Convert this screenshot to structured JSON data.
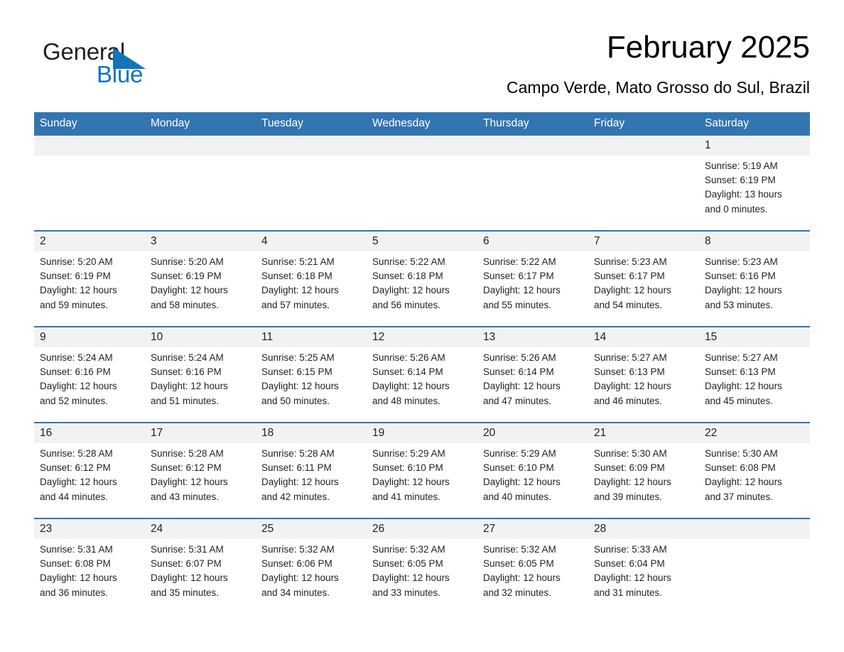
{
  "brand": {
    "name_part1": "General",
    "name_part2": "Blue",
    "triangle_color": "#1573ba",
    "text_color": "#231f20"
  },
  "header": {
    "title": "February 2025",
    "subtitle": "Campo Verde, Mato Grosso do Sul, Brazil"
  },
  "theme": {
    "header_blue": "#3375b0",
    "row_border_blue": "#3375b0",
    "daynum_background": "#f2f2f2",
    "text": "#231f20",
    "page_background": "#ffffff"
  },
  "calendar": {
    "weekday_headers": [
      "Sunday",
      "Monday",
      "Tuesday",
      "Wednesday",
      "Thursday",
      "Friday",
      "Saturday"
    ],
    "weeks": [
      [
        {
          "blank": true,
          "day": ""
        },
        {
          "blank": true,
          "day": ""
        },
        {
          "blank": true,
          "day": ""
        },
        {
          "blank": true,
          "day": ""
        },
        {
          "blank": true,
          "day": ""
        },
        {
          "blank": true,
          "day": ""
        },
        {
          "blank": false,
          "day": "1",
          "sunrise": "Sunrise: 5:19 AM",
          "sunset": "Sunset: 6:19 PM",
          "daylight_line1": "Daylight: 13 hours",
          "daylight_line2": "and 0 minutes."
        }
      ],
      [
        {
          "blank": false,
          "day": "2",
          "sunrise": "Sunrise: 5:20 AM",
          "sunset": "Sunset: 6:19 PM",
          "daylight_line1": "Daylight: 12 hours",
          "daylight_line2": "and 59 minutes."
        },
        {
          "blank": false,
          "day": "3",
          "sunrise": "Sunrise: 5:20 AM",
          "sunset": "Sunset: 6:19 PM",
          "daylight_line1": "Daylight: 12 hours",
          "daylight_line2": "and 58 minutes."
        },
        {
          "blank": false,
          "day": "4",
          "sunrise": "Sunrise: 5:21 AM",
          "sunset": "Sunset: 6:18 PM",
          "daylight_line1": "Daylight: 12 hours",
          "daylight_line2": "and 57 minutes."
        },
        {
          "blank": false,
          "day": "5",
          "sunrise": "Sunrise: 5:22 AM",
          "sunset": "Sunset: 6:18 PM",
          "daylight_line1": "Daylight: 12 hours",
          "daylight_line2": "and 56 minutes."
        },
        {
          "blank": false,
          "day": "6",
          "sunrise": "Sunrise: 5:22 AM",
          "sunset": "Sunset: 6:17 PM",
          "daylight_line1": "Daylight: 12 hours",
          "daylight_line2": "and 55 minutes."
        },
        {
          "blank": false,
          "day": "7",
          "sunrise": "Sunrise: 5:23 AM",
          "sunset": "Sunset: 6:17 PM",
          "daylight_line1": "Daylight: 12 hours",
          "daylight_line2": "and 54 minutes."
        },
        {
          "blank": false,
          "day": "8",
          "sunrise": "Sunrise: 5:23 AM",
          "sunset": "Sunset: 6:16 PM",
          "daylight_line1": "Daylight: 12 hours",
          "daylight_line2": "and 53 minutes."
        }
      ],
      [
        {
          "blank": false,
          "day": "9",
          "sunrise": "Sunrise: 5:24 AM",
          "sunset": "Sunset: 6:16 PM",
          "daylight_line1": "Daylight: 12 hours",
          "daylight_line2": "and 52 minutes."
        },
        {
          "blank": false,
          "day": "10",
          "sunrise": "Sunrise: 5:24 AM",
          "sunset": "Sunset: 6:16 PM",
          "daylight_line1": "Daylight: 12 hours",
          "daylight_line2": "and 51 minutes."
        },
        {
          "blank": false,
          "day": "11",
          "sunrise": "Sunrise: 5:25 AM",
          "sunset": "Sunset: 6:15 PM",
          "daylight_line1": "Daylight: 12 hours",
          "daylight_line2": "and 50 minutes."
        },
        {
          "blank": false,
          "day": "12",
          "sunrise": "Sunrise: 5:26 AM",
          "sunset": "Sunset: 6:14 PM",
          "daylight_line1": "Daylight: 12 hours",
          "daylight_line2": "and 48 minutes."
        },
        {
          "blank": false,
          "day": "13",
          "sunrise": "Sunrise: 5:26 AM",
          "sunset": "Sunset: 6:14 PM",
          "daylight_line1": "Daylight: 12 hours",
          "daylight_line2": "and 47 minutes."
        },
        {
          "blank": false,
          "day": "14",
          "sunrise": "Sunrise: 5:27 AM",
          "sunset": "Sunset: 6:13 PM",
          "daylight_line1": "Daylight: 12 hours",
          "daylight_line2": "and 46 minutes."
        },
        {
          "blank": false,
          "day": "15",
          "sunrise": "Sunrise: 5:27 AM",
          "sunset": "Sunset: 6:13 PM",
          "daylight_line1": "Daylight: 12 hours",
          "daylight_line2": "and 45 minutes."
        }
      ],
      [
        {
          "blank": false,
          "day": "16",
          "sunrise": "Sunrise: 5:28 AM",
          "sunset": "Sunset: 6:12 PM",
          "daylight_line1": "Daylight: 12 hours",
          "daylight_line2": "and 44 minutes."
        },
        {
          "blank": false,
          "day": "17",
          "sunrise": "Sunrise: 5:28 AM",
          "sunset": "Sunset: 6:12 PM",
          "daylight_line1": "Daylight: 12 hours",
          "daylight_line2": "and 43 minutes."
        },
        {
          "blank": false,
          "day": "18",
          "sunrise": "Sunrise: 5:28 AM",
          "sunset": "Sunset: 6:11 PM",
          "daylight_line1": "Daylight: 12 hours",
          "daylight_line2": "and 42 minutes."
        },
        {
          "blank": false,
          "day": "19",
          "sunrise": "Sunrise: 5:29 AM",
          "sunset": "Sunset: 6:10 PM",
          "daylight_line1": "Daylight: 12 hours",
          "daylight_line2": "and 41 minutes."
        },
        {
          "blank": false,
          "day": "20",
          "sunrise": "Sunrise: 5:29 AM",
          "sunset": "Sunset: 6:10 PM",
          "daylight_line1": "Daylight: 12 hours",
          "daylight_line2": "and 40 minutes."
        },
        {
          "blank": false,
          "day": "21",
          "sunrise": "Sunrise: 5:30 AM",
          "sunset": "Sunset: 6:09 PM",
          "daylight_line1": "Daylight: 12 hours",
          "daylight_line2": "and 39 minutes."
        },
        {
          "blank": false,
          "day": "22",
          "sunrise": "Sunrise: 5:30 AM",
          "sunset": "Sunset: 6:08 PM",
          "daylight_line1": "Daylight: 12 hours",
          "daylight_line2": "and 37 minutes."
        }
      ],
      [
        {
          "blank": false,
          "day": "23",
          "sunrise": "Sunrise: 5:31 AM",
          "sunset": "Sunset: 6:08 PM",
          "daylight_line1": "Daylight: 12 hours",
          "daylight_line2": "and 36 minutes."
        },
        {
          "blank": false,
          "day": "24",
          "sunrise": "Sunrise: 5:31 AM",
          "sunset": "Sunset: 6:07 PM",
          "daylight_line1": "Daylight: 12 hours",
          "daylight_line2": "and 35 minutes."
        },
        {
          "blank": false,
          "day": "25",
          "sunrise": "Sunrise: 5:32 AM",
          "sunset": "Sunset: 6:06 PM",
          "daylight_line1": "Daylight: 12 hours",
          "daylight_line2": "and 34 minutes."
        },
        {
          "blank": false,
          "day": "26",
          "sunrise": "Sunrise: 5:32 AM",
          "sunset": "Sunset: 6:05 PM",
          "daylight_line1": "Daylight: 12 hours",
          "daylight_line2": "and 33 minutes."
        },
        {
          "blank": false,
          "day": "27",
          "sunrise": "Sunrise: 5:32 AM",
          "sunset": "Sunset: 6:05 PM",
          "daylight_line1": "Daylight: 12 hours",
          "daylight_line2": "and 32 minutes."
        },
        {
          "blank": false,
          "day": "28",
          "sunrise": "Sunrise: 5:33 AM",
          "sunset": "Sunset: 6:04 PM",
          "daylight_line1": "Daylight: 12 hours",
          "daylight_line2": "and 31 minutes."
        },
        {
          "blank": true,
          "day": ""
        }
      ]
    ]
  }
}
